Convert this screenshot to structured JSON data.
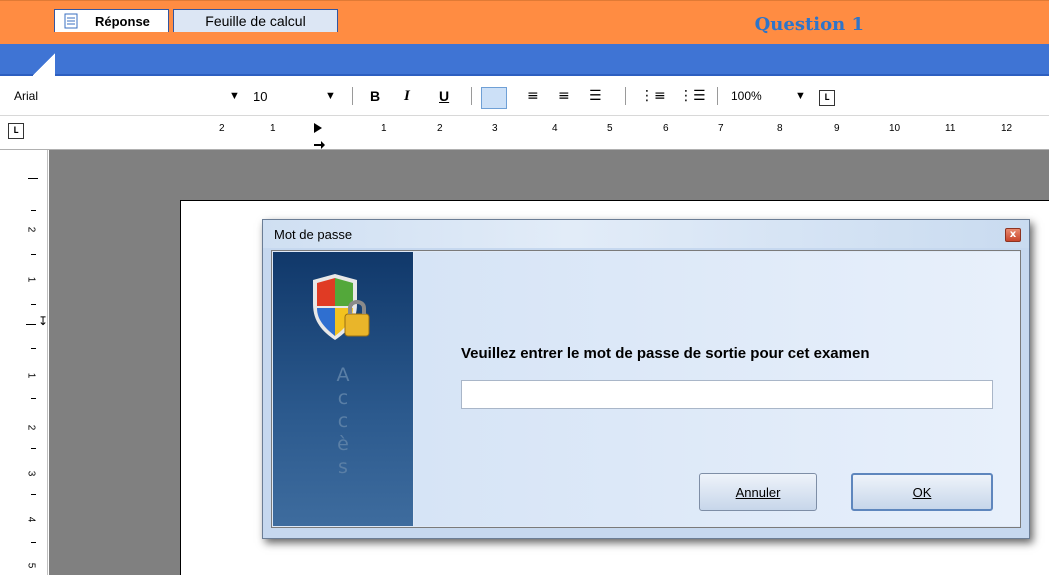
{
  "header": {
    "title": "Question 1"
  },
  "tabs": [
    {
      "label": "Réponse",
      "active": true
    },
    {
      "label": "Feuille de calcul",
      "active": false
    }
  ],
  "toolbar": {
    "font_name": "Arial",
    "font_size": "10",
    "bold_label": "B",
    "italic_label": "I",
    "underline_label": "U",
    "zoom": "100%",
    "icons": [
      "chevron-down-icon",
      "align-left-icon",
      "align-center-icon",
      "align-right-icon",
      "justify-icon",
      "numbered-list-icon",
      "bullet-list-icon",
      "tab-stop-icon"
    ]
  },
  "ruler": {
    "labels": [
      "2",
      "1",
      "1",
      "2",
      "3",
      "4",
      "5",
      "6",
      "7",
      "8",
      "9",
      "10",
      "11",
      "12"
    ]
  },
  "left_ruler": {
    "labels": [
      "2",
      "1",
      "1",
      "2",
      "3",
      "4",
      "5"
    ]
  },
  "dialog": {
    "title": "Mot de passe",
    "sidebar_text": [
      "A",
      "c",
      "c",
      "è",
      "s"
    ],
    "prompt": "Veuillez entrer le mot de passe de sortie pour cet examen",
    "password_value": "",
    "cancel_label": "Annuler",
    "ok_label": "OK"
  },
  "colors": {
    "header_bg": "#ff8c42",
    "header_title": "#2e74c9",
    "tabstrip_bg": "#3f74d4",
    "doc_bg": "#808080",
    "dialog_sidebar": "#10386a"
  }
}
